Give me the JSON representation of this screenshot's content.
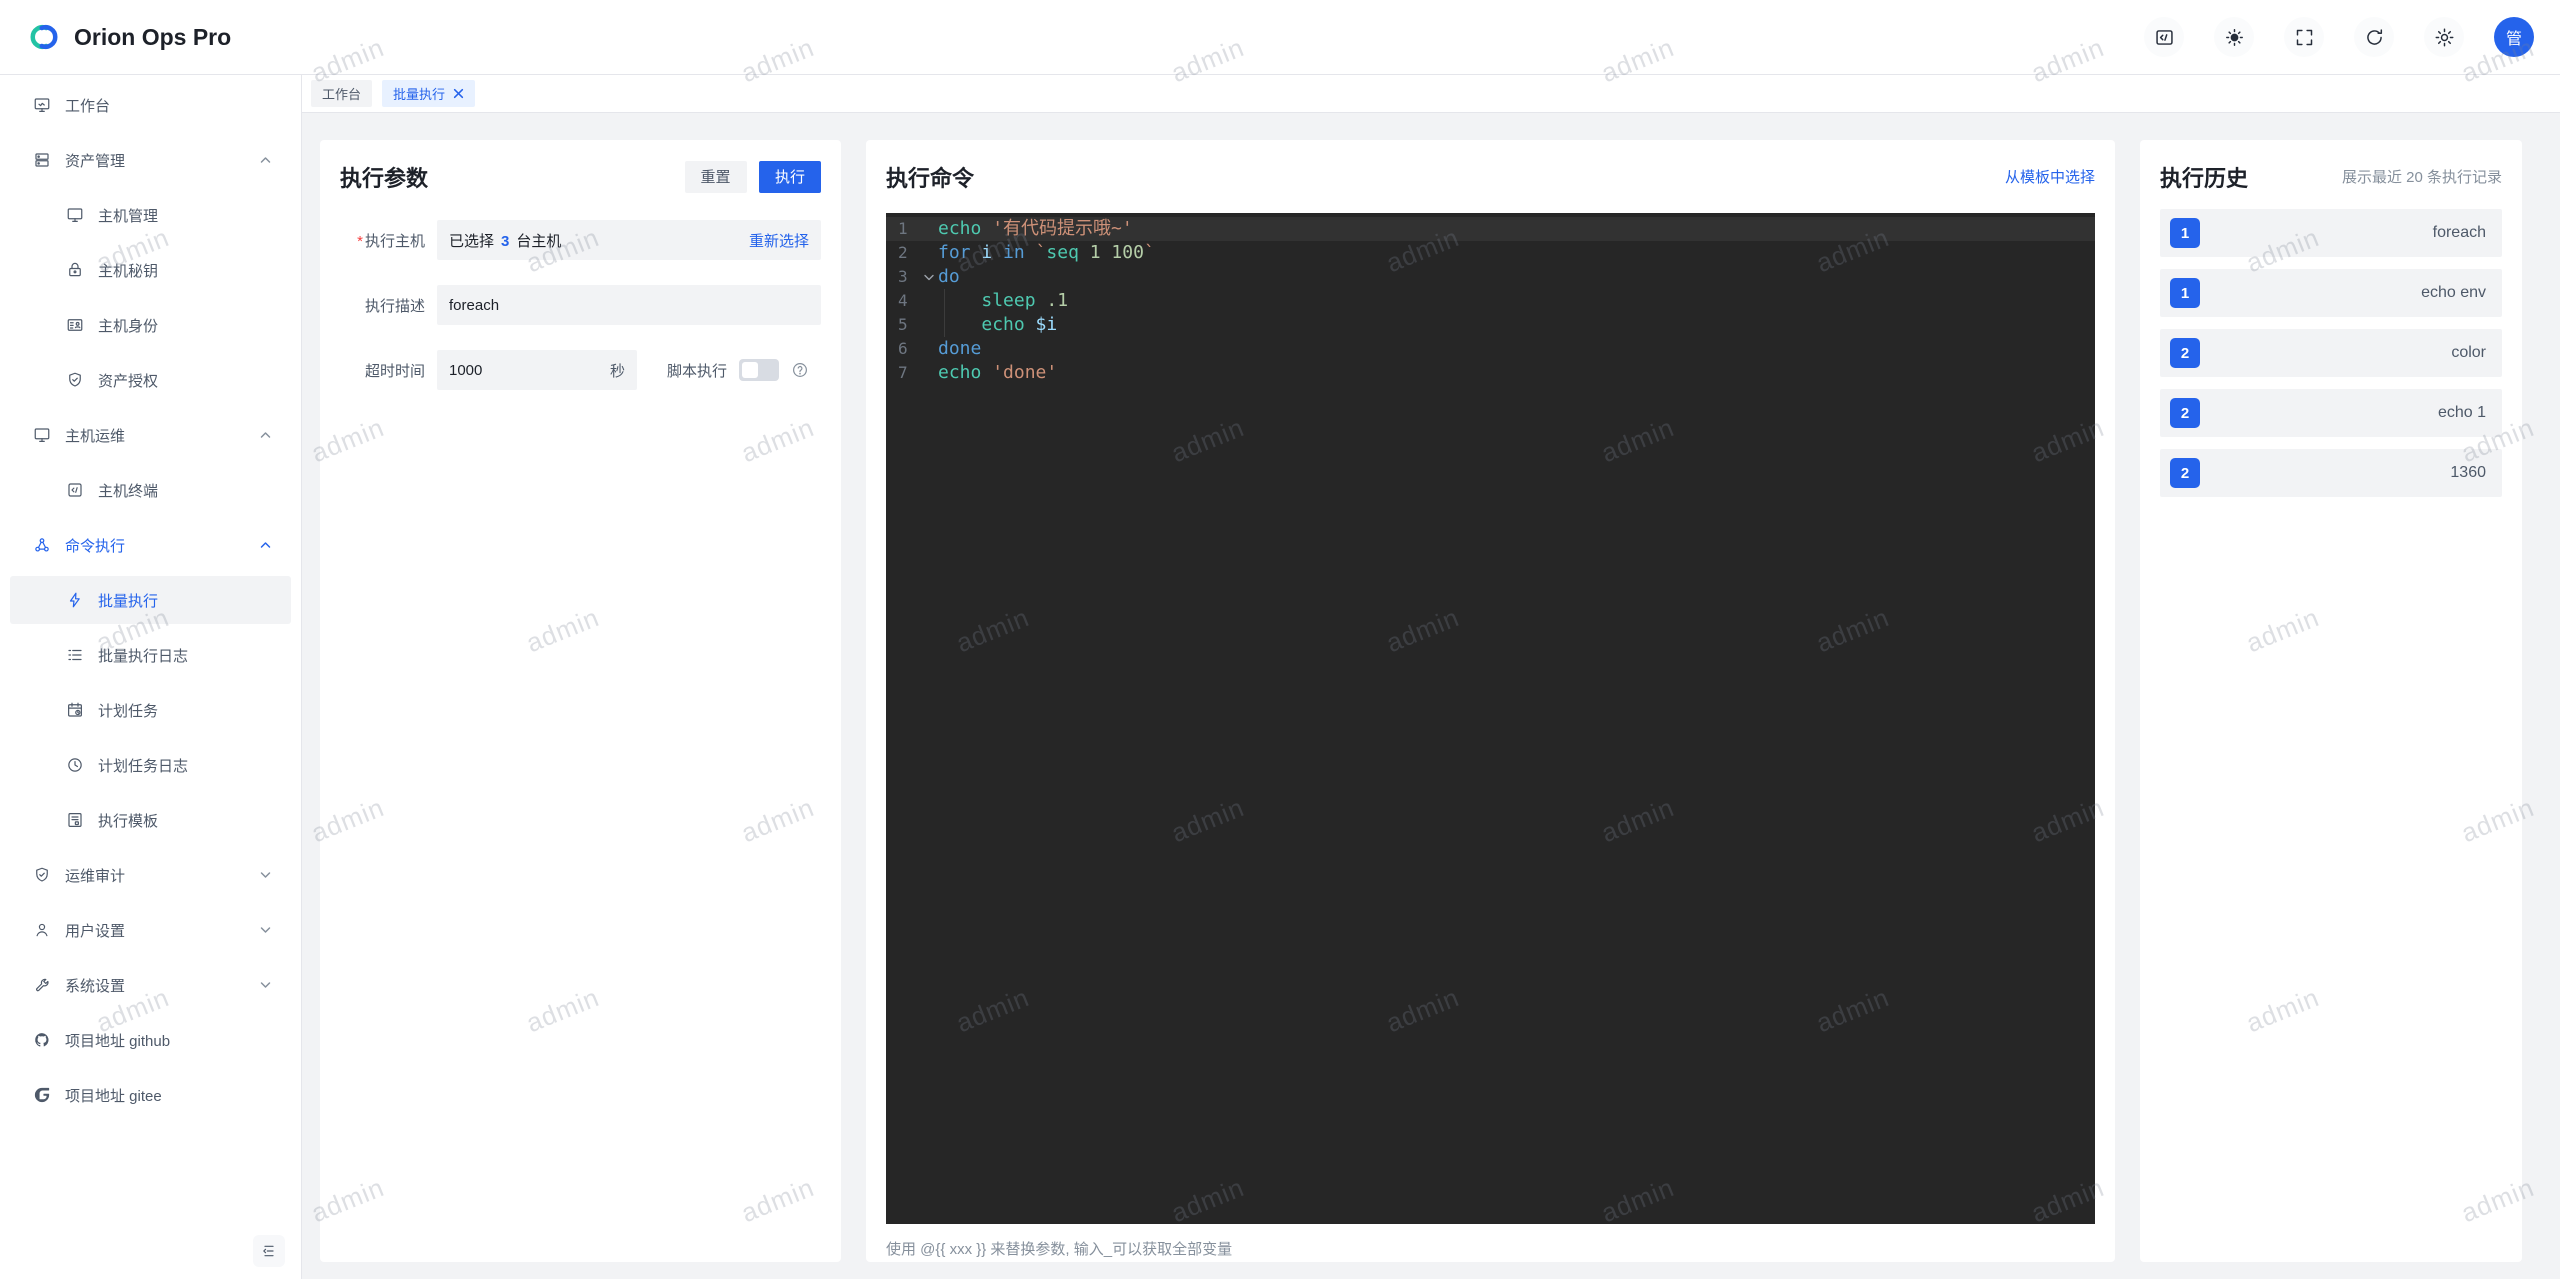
{
  "header": {
    "app_name": "Orion Ops Pro",
    "avatar_text": "管",
    "action_icons": [
      "terminal-icon",
      "theme-sun-icon",
      "fullscreen-icon",
      "refresh-icon",
      "settings-gear-icon"
    ]
  },
  "tabs": [
    {
      "label": "工作台",
      "active": false
    },
    {
      "label": "批量执行",
      "active": true,
      "closable": true
    }
  ],
  "sidebar": {
    "items": [
      {
        "label": "工作台",
        "type": "top",
        "icon": "workbench-icon"
      },
      {
        "label": "资产管理",
        "type": "group",
        "state": "expanded",
        "icon": "assets-icon"
      },
      {
        "label": "主机管理",
        "type": "child",
        "icon": "host-monitor-icon"
      },
      {
        "label": "主机秘钥",
        "type": "child",
        "icon": "lock-icon"
      },
      {
        "label": "主机身份",
        "type": "child",
        "icon": "idcard-icon"
      },
      {
        "label": "资产授权",
        "type": "child",
        "icon": "shield-check-icon"
      },
      {
        "label": "主机运维",
        "type": "group",
        "state": "expanded",
        "icon": "monitor-icon"
      },
      {
        "label": "主机终端",
        "type": "child",
        "icon": "code-square-icon"
      },
      {
        "label": "命令执行",
        "type": "group",
        "state": "expanded",
        "active": true,
        "icon": "nodes-icon"
      },
      {
        "label": "批量执行",
        "type": "child",
        "selected": true,
        "icon": "lightning-icon"
      },
      {
        "label": "批量执行日志",
        "type": "child",
        "icon": "list-icon"
      },
      {
        "label": "计划任务",
        "type": "child",
        "icon": "calendar-clock-icon"
      },
      {
        "label": "计划任务日志",
        "type": "child",
        "icon": "clock-icon"
      },
      {
        "label": "执行模板",
        "type": "child",
        "icon": "template-icon"
      },
      {
        "label": "运维审计",
        "type": "group",
        "state": "collapsed",
        "icon": "shield-check-icon"
      },
      {
        "label": "用户设置",
        "type": "group",
        "state": "collapsed",
        "icon": "user-icon"
      },
      {
        "label": "系统设置",
        "type": "group",
        "state": "collapsed",
        "icon": "wrench-icon"
      },
      {
        "label": "项目地址 github",
        "type": "top",
        "icon": "github-icon"
      },
      {
        "label": "项目地址 gitee",
        "type": "top",
        "icon": "gitee-icon"
      }
    ]
  },
  "params_panel": {
    "title": "执行参数",
    "reset_label": "重置",
    "run_label": "执行",
    "host_label": "执行主机",
    "host_prefix": "已选择",
    "host_count": "3",
    "host_suffix": "台主机",
    "reselect_label": "重新选择",
    "desc_label": "执行描述",
    "desc_value": "foreach",
    "timeout_label": "超时时间",
    "timeout_value": "1000",
    "timeout_unit": "秒",
    "script_label": "脚本执行"
  },
  "command_panel": {
    "title": "执行命令",
    "template_link": "从模板中选择",
    "hint": "使用 @{{ xxx }} 来替换参数, 输入_可以获取全部变量",
    "editor": {
      "lines": [
        {
          "num": "1",
          "tokens": [
            {
              "text": "echo ",
              "type": "cmd"
            },
            {
              "text": "'有代码提示哦~'",
              "type": "str"
            }
          ]
        },
        {
          "num": "2",
          "tokens": [
            {
              "text": "for ",
              "type": "kw"
            },
            {
              "text": "i ",
              "type": "var"
            },
            {
              "text": "in ",
              "type": "kw"
            },
            {
              "text": "`",
              "type": "str"
            },
            {
              "text": "seq",
              "type": "cmd"
            },
            {
              "text": " 1 100",
              "type": "num"
            },
            {
              "text": "`",
              "type": "str"
            }
          ]
        },
        {
          "num": "3",
          "tokens": [
            {
              "text": "do",
              "type": "kw"
            }
          ]
        },
        {
          "num": "4",
          "tokens": [
            {
              "text": "    ",
              "type": "plain"
            },
            {
              "text": "sleep",
              "type": "cmd"
            },
            {
              "text": " .1",
              "type": "num"
            }
          ]
        },
        {
          "num": "5",
          "tokens": [
            {
              "text": "    ",
              "type": "plain"
            },
            {
              "text": "echo ",
              "type": "cmd"
            },
            {
              "text": "$i",
              "type": "var"
            }
          ]
        },
        {
          "num": "6",
          "tokens": [
            {
              "text": "done",
              "type": "kw"
            }
          ]
        },
        {
          "num": "7",
          "tokens": [
            {
              "text": "echo ",
              "type": "cmd"
            },
            {
              "text": "'done'",
              "type": "str"
            }
          ]
        }
      ]
    }
  },
  "history_panel": {
    "title": "执行历史",
    "subtitle": "展示最近 20 条执行记录",
    "items": [
      {
        "badge": "1",
        "label": "foreach"
      },
      {
        "badge": "1",
        "label": "echo env"
      },
      {
        "badge": "2",
        "label": "color"
      },
      {
        "badge": "2",
        "label": "echo 1"
      },
      {
        "badge": "2",
        "label": "1360"
      }
    ]
  },
  "watermark": {
    "text": "admin"
  },
  "colors": {
    "primary": "#2563eb",
    "content_bg": "#f2f3f5",
    "editor_bg": "#262626",
    "token_cmd": "#4ec9b0",
    "token_keyword": "#569cd6",
    "token_string": "#ce9178",
    "token_number": "#b5cea8",
    "token_variable": "#9cdcfe"
  }
}
